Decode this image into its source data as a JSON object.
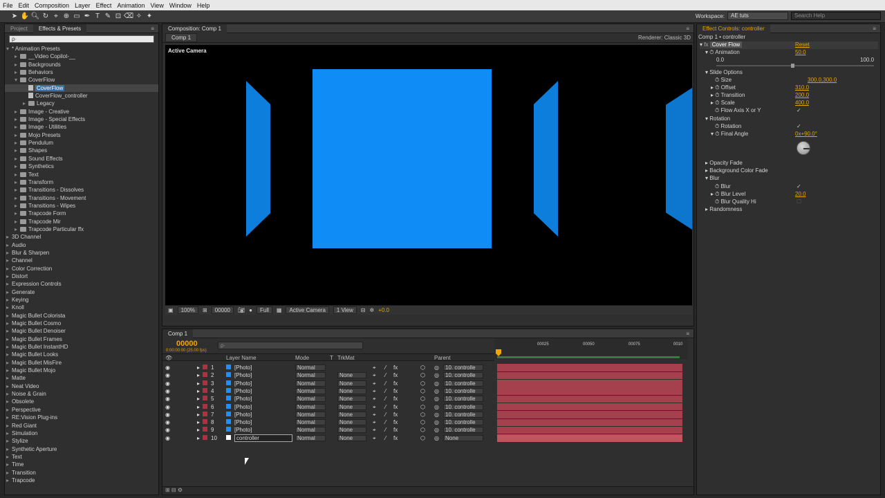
{
  "menu": [
    "File",
    "Edit",
    "Composition",
    "Layer",
    "Effect",
    "Animation",
    "View",
    "Window",
    "Help"
  ],
  "workspace": {
    "label": "Workspace:",
    "value": "AE tuts",
    "search_placeholder": "Search Help"
  },
  "left_panel": {
    "tabs": [
      "Project",
      "Effects & Presets"
    ],
    "search_placeholder": "ρ·",
    "tree": [
      {
        "label": "* Animation Presets",
        "level": 0,
        "open": true
      },
      {
        "label": "__Video Copilot-__",
        "level": 1,
        "folder": true
      },
      {
        "label": "Backgrounds",
        "level": 1,
        "folder": true
      },
      {
        "label": "Behaviors",
        "level": 1,
        "folder": true
      },
      {
        "label": "CoverFlow",
        "level": 1,
        "folder": true,
        "open": true
      },
      {
        "label": "CoverFlow",
        "level": 2,
        "file": true,
        "selected": true
      },
      {
        "label": "CoverFlow_controller",
        "level": 2,
        "file": true
      },
      {
        "label": "Legacy",
        "level": 2,
        "folder": true
      },
      {
        "label": "Image - Creative",
        "level": 1,
        "folder": true
      },
      {
        "label": "Image - Special Effects",
        "level": 1,
        "folder": true
      },
      {
        "label": "Image - Utilities",
        "level": 1,
        "folder": true
      },
      {
        "label": "Mojo Presets",
        "level": 1,
        "folder": true
      },
      {
        "label": "Pendulum",
        "level": 1,
        "folder": true
      },
      {
        "label": "Shapes",
        "level": 1,
        "folder": true
      },
      {
        "label": "Sound Effects",
        "level": 1,
        "folder": true
      },
      {
        "label": "Synthetics",
        "level": 1,
        "folder": true
      },
      {
        "label": "Text",
        "level": 1,
        "folder": true
      },
      {
        "label": "Transform",
        "level": 1,
        "folder": true
      },
      {
        "label": "Transitions - Dissolves",
        "level": 1,
        "folder": true
      },
      {
        "label": "Transitions - Movement",
        "level": 1,
        "folder": true
      },
      {
        "label": "Transitions - Wipes",
        "level": 1,
        "folder": true
      },
      {
        "label": "Trapcode Form",
        "level": 1,
        "folder": true
      },
      {
        "label": "Trapcode Mir",
        "level": 1,
        "folder": true
      },
      {
        "label": "Trapcode Particular ffx",
        "level": 1,
        "folder": true
      },
      {
        "label": "3D Channel",
        "level": 0
      },
      {
        "label": "Audio",
        "level": 0
      },
      {
        "label": "Blur & Sharpen",
        "level": 0
      },
      {
        "label": "Channel",
        "level": 0
      },
      {
        "label": "Color Correction",
        "level": 0
      },
      {
        "label": "Distort",
        "level": 0
      },
      {
        "label": "Expression Controls",
        "level": 0
      },
      {
        "label": "Generate",
        "level": 0
      },
      {
        "label": "Keying",
        "level": 0
      },
      {
        "label": "Knoll",
        "level": 0
      },
      {
        "label": "Magic Bullet Colorista",
        "level": 0
      },
      {
        "label": "Magic Bullet Cosmo",
        "level": 0
      },
      {
        "label": "Magic Bullet Denoiser",
        "level": 0
      },
      {
        "label": "Magic Bullet Frames",
        "level": 0
      },
      {
        "label": "Magic Bullet InstantHD",
        "level": 0
      },
      {
        "label": "Magic Bullet Looks",
        "level": 0
      },
      {
        "label": "Magic Bullet MisFire",
        "level": 0
      },
      {
        "label": "Magic Bullet Mojo",
        "level": 0
      },
      {
        "label": "Matte",
        "level": 0
      },
      {
        "label": "Neat Video",
        "level": 0
      },
      {
        "label": "Noise & Grain",
        "level": 0
      },
      {
        "label": "Obsolete",
        "level": 0
      },
      {
        "label": "Perspective",
        "level": 0
      },
      {
        "label": "RE:Vision Plug-ins",
        "level": 0
      },
      {
        "label": "Red Giant",
        "level": 0
      },
      {
        "label": "Simulation",
        "level": 0
      },
      {
        "label": "Stylize",
        "level": 0
      },
      {
        "label": "Synthetic Aperture",
        "level": 0
      },
      {
        "label": "Text",
        "level": 0
      },
      {
        "label": "Time",
        "level": 0
      },
      {
        "label": "Transition",
        "level": 0
      },
      {
        "label": "Trapcode",
        "level": 0
      }
    ]
  },
  "composition": {
    "tab": "Composition: Comp 1",
    "sub_tab": "Comp 1",
    "renderer": "Renderer:  Classic 3D",
    "view_label": "Active Camera",
    "footer": {
      "zoom": "100%",
      "timecode": "00000",
      "resolution": "Full",
      "camera": "Active Camera",
      "views": "1 View",
      "exposure": "+0.0"
    }
  },
  "timeline": {
    "tab": "Comp 1",
    "timecode": "00000",
    "fps": "0:00:00:00 (25.00 fps)",
    "headers": {
      "layer_name": "Layer Name",
      "mode": "Mode",
      "t": "T",
      "trkmat": "TrkMat",
      "parent": "Parent"
    },
    "ruler": [
      "00025",
      "00050",
      "00075",
      "0010"
    ],
    "layers": [
      {
        "num": "1",
        "name": "[Photo]",
        "mode": "Normal",
        "trkmat": "",
        "parent": "10. controlle",
        "color": "#1e8fff"
      },
      {
        "num": "2",
        "name": "[Photo]",
        "mode": "Normal",
        "trkmat": "None",
        "parent": "10. controlle",
        "color": "#1e8fff"
      },
      {
        "num": "3",
        "name": "[Photo]",
        "mode": "Normal",
        "trkmat": "None",
        "parent": "10. controlle",
        "color": "#1e8fff"
      },
      {
        "num": "4",
        "name": "[Photo]",
        "mode": "Normal",
        "trkmat": "None",
        "parent": "10. controlle",
        "color": "#1e8fff"
      },
      {
        "num": "5",
        "name": "[Photo]",
        "mode": "Normal",
        "trkmat": "None",
        "parent": "10. controlle",
        "color": "#1e8fff"
      },
      {
        "num": "6",
        "name": "[Photo]",
        "mode": "Normal",
        "trkmat": "None",
        "parent": "10. controlle",
        "color": "#1e8fff"
      },
      {
        "num": "7",
        "name": "[Photo]",
        "mode": "Normal",
        "trkmat": "None",
        "parent": "10. controlle",
        "color": "#1e8fff"
      },
      {
        "num": "8",
        "name": "[Photo]",
        "mode": "Normal",
        "trkmat": "None",
        "parent": "10. controlle",
        "color": "#1e8fff"
      },
      {
        "num": "9",
        "name": "[Photo]",
        "mode": "Normal",
        "trkmat": "None",
        "parent": "10. controlle",
        "color": "#1e8fff"
      },
      {
        "num": "10",
        "name": "controller",
        "mode": "Normal",
        "trkmat": "None",
        "parent": "None",
        "color": "#ffffff"
      }
    ]
  },
  "effect_controls": {
    "tab": "Effect Controls: controller",
    "breadcrumb": "Comp 1 • controller",
    "effect_name": "Cover Flow",
    "reset": "Reset",
    "animation": {
      "label": "Animation",
      "value": "50.0",
      "min": "0.0",
      "max": "100.0"
    },
    "slide_options": "Slide Options",
    "size": {
      "label": "Size",
      "value": "300.0,300.0"
    },
    "offset": {
      "label": "Offset",
      "value": "310.0"
    },
    "transition": {
      "label": "Transition",
      "value": "200.0"
    },
    "scale": {
      "label": "Scale",
      "value": "400.0"
    },
    "flow_axis": {
      "label": "Flow Axis X or Y"
    },
    "rotation_group": "Rotation",
    "rotation": {
      "label": "Rotation"
    },
    "final_angle": {
      "label": "Final Angle",
      "value": "0x+90.0°"
    },
    "opacity_fade": "Opacity Fade",
    "bg_fade": "Background Color Fade",
    "blur_group": "Blur",
    "blur": {
      "label": "Blur"
    },
    "blur_level": {
      "label": "Blur Level",
      "value": "20.0"
    },
    "blur_quality": {
      "label": "Blur Quality Hi"
    },
    "randomness": "Randomness"
  }
}
